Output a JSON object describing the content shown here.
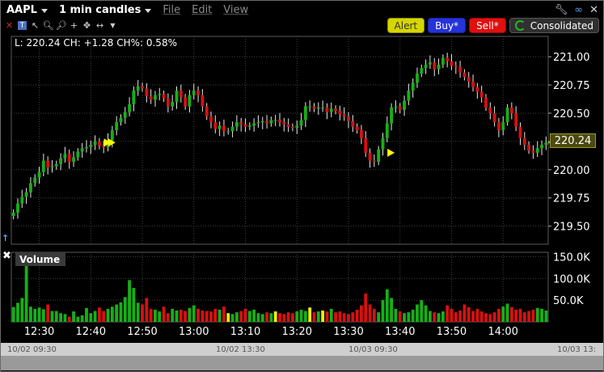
{
  "header": {
    "symbol": "AAPL",
    "interval": "1 min candles",
    "menus": [
      "File",
      "Edit",
      "View"
    ]
  },
  "buttons": {
    "alert": "Alert",
    "buy": "Buy*",
    "sell": "Sell*",
    "consolidated": "Consolidated"
  },
  "info": {
    "text": "L: 220.24 CH: +1.28 CH%: 0.58%"
  },
  "price_badge": "220.24",
  "volume_label": "Volume",
  "colors": {
    "up": "#16b016",
    "down": "#d81010",
    "volume_neutral": "#f2f200",
    "grid": "#404040",
    "badge": "#9a9a30"
  },
  "date_strip": [
    "10/02 09:30",
    "10/02 13:30",
    "10/03 09:30",
    "10/03 13:"
  ],
  "chart_data": [
    {
      "type": "candlestick",
      "title": "AAPL 1 min candles",
      "yticks": [
        "221.00",
        "220.75",
        "220.50",
        "220.25",
        "220.00",
        "219.75",
        "219.50"
      ],
      "ytick_values": [
        221.0,
        220.75,
        220.5,
        220.25,
        220.0,
        219.75,
        219.5
      ],
      "ylim": [
        219.34,
        221.18
      ],
      "xticks": [
        "12:30",
        "12:40",
        "12:50",
        "13:00",
        "13:10",
        "13:20",
        "13:30",
        "13:40",
        "13:50",
        "14:00"
      ],
      "xtick_index": [
        6,
        18,
        30,
        42,
        54,
        66,
        78,
        90,
        102,
        114
      ],
      "close": [
        219.62,
        219.7,
        219.76,
        219.8,
        219.88,
        219.93,
        219.98,
        220.08,
        220.02,
        220.03,
        220.05,
        220.1,
        220.14,
        220.07,
        220.11,
        220.16,
        220.19,
        220.2,
        220.22,
        220.25,
        220.21,
        220.2,
        220.26,
        220.35,
        220.42,
        220.46,
        220.51,
        220.58,
        220.7,
        220.74,
        220.72,
        220.65,
        220.62,
        220.66,
        220.67,
        220.63,
        220.56,
        220.6,
        220.7,
        220.64,
        220.56,
        220.66,
        220.7,
        220.66,
        220.56,
        220.47,
        220.42,
        220.36,
        220.39,
        220.34,
        220.34,
        220.38,
        220.42,
        220.4,
        220.38,
        220.39,
        220.41,
        220.42,
        220.43,
        220.41,
        220.44,
        220.44,
        220.42,
        220.4,
        220.38,
        220.37,
        220.39,
        220.44,
        220.56,
        220.56,
        220.54,
        220.55,
        220.55,
        220.51,
        220.54,
        220.52,
        220.49,
        220.47,
        220.43,
        220.38,
        220.35,
        220.28,
        220.15,
        220.08,
        220.07,
        220.18,
        220.28,
        220.41,
        220.55,
        220.56,
        220.53,
        220.61,
        220.7,
        220.77,
        220.85,
        220.9,
        220.93,
        220.95,
        220.89,
        220.93,
        220.99,
        220.96,
        220.92,
        220.91,
        220.86,
        220.82,
        220.78,
        220.73,
        220.69,
        220.64,
        220.55,
        220.5,
        220.42,
        220.35,
        220.42,
        220.55,
        220.5,
        220.38,
        220.28,
        220.22,
        220.17,
        220.15,
        220.19,
        220.22,
        220.24
      ],
      "volume": [
        34000,
        44000,
        55000,
        158000,
        35000,
        30000,
        33000,
        29000,
        40000,
        25000,
        25000,
        20000,
        18000,
        12000,
        24000,
        12000,
        15000,
        32000,
        20000,
        25000,
        33000,
        25000,
        30000,
        35000,
        40000,
        45000,
        57000,
        96000,
        78000,
        44000,
        40000,
        55000,
        30000,
        28000,
        24000,
        35000,
        20000,
        30000,
        26000,
        28000,
        25000,
        32000,
        38000,
        30000,
        26000,
        25000,
        24000,
        30000,
        28000,
        35000,
        20000,
        18000,
        22000,
        25000,
        30000,
        25000,
        28000,
        20000,
        18000,
        22000,
        20000,
        24000,
        20000,
        18000,
        22000,
        20000,
        24000,
        28000,
        25000,
        33000,
        22000,
        24000,
        26000,
        24000,
        30000,
        22000,
        24000,
        20000,
        18000,
        22000,
        28000,
        38000,
        65000,
        40000,
        30000,
        22000,
        50000,
        75000,
        55000,
        30000,
        24000,
        20000,
        22000,
        28000,
        40000,
        50000,
        38000,
        25000,
        22000,
        20000,
        24000,
        38000,
        30000,
        22000,
        26000,
        40000,
        34000,
        25000,
        30000,
        24000,
        20000,
        18000,
        22000,
        30000,
        35000,
        42000,
        34000,
        28000,
        30000,
        22000,
        25000,
        28000,
        32000,
        30000,
        26000
      ],
      "volume_ylim": [
        0,
        160000
      ],
      "volume_ticks": [
        "150.0K",
        "100.0K",
        "50.0K"
      ],
      "volume_tick_values": [
        150000,
        100000,
        50000
      ],
      "grid": true,
      "legend": "none"
    }
  ]
}
